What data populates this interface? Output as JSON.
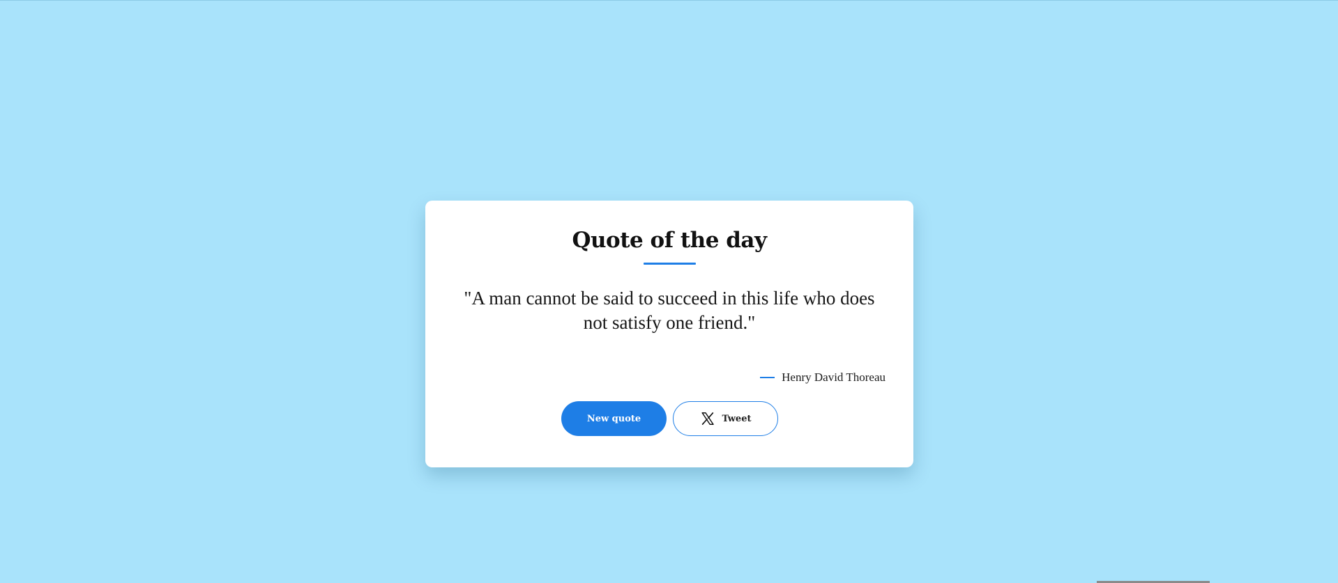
{
  "page": {
    "background_color": "#a9e3fb",
    "accent_color": "#1e7ee6"
  },
  "card": {
    "title": "Quote of the day",
    "quote_text": "\"A man cannot be said to succeed in this life who does not satisfy one friend.\"",
    "author": "Henry David Thoreau"
  },
  "buttons": {
    "new_quote_label": "New quote",
    "tweet_label": "Tweet",
    "tweet_icon": "x-logo-icon"
  }
}
